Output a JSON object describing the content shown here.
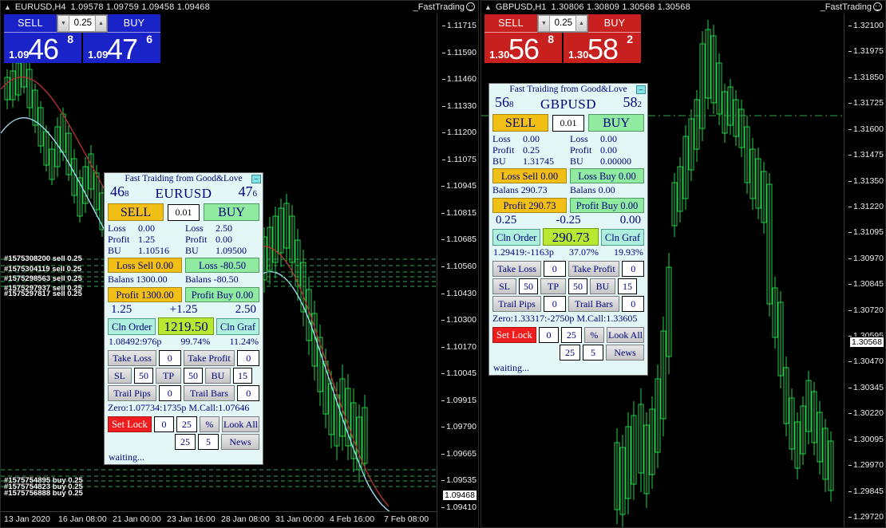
{
  "charts": [
    {
      "id": "left",
      "header": {
        "symbol": "EURUSD,H4",
        "ohlc": "1.09578 1.09759 1.09458 1.09468",
        "right_label": "_FastTrading",
        "smiley_icon": "smiley-icon",
        "arrow_icon": "triangle-up-icon"
      },
      "oneclick": {
        "sell_label": "SELL",
        "buy_label": "BUY",
        "volume": "0.25",
        "down_icon": "chevron-down-icon",
        "up_icon": "chevron-up-icon",
        "sell_price": {
          "prefix": "1.09",
          "big": "46",
          "sup": "8"
        },
        "buy_price": {
          "prefix": "1.09",
          "big": "47",
          "sup": "6"
        },
        "color": "#1a23c8"
      },
      "price_ticks": [
        "1.11715",
        "1.11590",
        "1.11460",
        "1.11330",
        "1.11200",
        "1.11075",
        "1.10945",
        "1.10815",
        "1.10685",
        "1.10560",
        "1.10430",
        "1.10300",
        "1.10170",
        "1.10045",
        "1.09915",
        "1.09790",
        "1.09665",
        "1.09535",
        "1.09410"
      ],
      "current_price": "1.09468",
      "time_ticks": [
        "13 Jan 2020",
        "16 Jan 08:00",
        "21 Jan 00:00",
        "23 Jan 16:00",
        "28 Jan 08:00",
        "31 Jan 00:00",
        "4 Feb 16:00",
        "7 Feb 08:00"
      ],
      "order_labels": [
        "#1575308200 sell 0.25",
        "#1575304119 sell 0.25",
        "#1575298563 sell 0.25",
        "#1575297937 sell 0.25",
        "#1575297817 sell 0.25",
        "#1575754895 buy 0.25",
        "#1575754823 buy 0.25",
        "#1575756888 buy 0.25"
      ]
    },
    {
      "id": "right",
      "header": {
        "symbol": "GBPUSD,H1",
        "ohlc": "1.30806 1.30809 1.30568 1.30568",
        "right_label": "_FastTrading",
        "smiley_icon": "smiley-icon",
        "arrow_icon": "triangle-up-icon"
      },
      "oneclick": {
        "sell_label": "SELL",
        "buy_label": "BUY",
        "volume": "0.25",
        "down_icon": "chevron-down-icon",
        "up_icon": "chevron-up-icon",
        "sell_price": {
          "prefix": "1.30",
          "big": "56",
          "sup": "8"
        },
        "buy_price": {
          "prefix": "1.30",
          "big": "58",
          "sup": "2"
        },
        "color": "#c81f1f"
      },
      "price_ticks": [
        "1.32100",
        "1.31975",
        "1.31850",
        "1.31725",
        "1.31600",
        "1.31475",
        "1.31350",
        "1.31220",
        "1.31095",
        "1.30970",
        "1.30845",
        "1.30720",
        "1.30595",
        "1.30470",
        "1.30345",
        "1.30220",
        "1.30095",
        "1.29970",
        "1.29845",
        "1.29720"
      ],
      "current_price": "1.30568",
      "time_ticks": [],
      "order_labels": []
    }
  ],
  "panels": [
    {
      "id": "eurusd-panel",
      "title": "Fast Traiding from Good&Love",
      "minimize_label": "–",
      "bid": "46",
      "bid_sub": "8",
      "symbol": "EURUSD",
      "ask": "47",
      "ask_sub": "6",
      "sell_label": "SELL",
      "buy_label": "BUY",
      "lot": "0.01",
      "sell_col": {
        "loss_label": "Loss",
        "loss_value": "0.00",
        "profit_label": "Profit",
        "profit_value": "1.25",
        "bu_label": "BU",
        "bu_value": "1.10516",
        "loss_btn": "Loss Sell 0.00",
        "balans_label": "Balans",
        "balans_value": "1300.00",
        "profit_btn": "Profit 1300.00"
      },
      "buy_col": {
        "loss_label": "Loss",
        "loss_value": "2.50",
        "profit_label": "Profit",
        "profit_value": "0.00",
        "bu_label": "BU",
        "bu_value": "1.09500",
        "loss_btn": "Loss -80.50",
        "balans_label": "Balans",
        "balans_value": "-80.50",
        "profit_btn": "Profit Buy 0.00"
      },
      "triple": {
        "left": "1.25",
        "mid": "+1.25",
        "right": "2.50"
      },
      "cln_order": "Cln Order",
      "total": "1219.50",
      "cln_graf": "Cln Graf",
      "stats": {
        "left": "1.08492:976p",
        "mid": "99.74%",
        "right": "11.24%"
      },
      "take_loss_label": "Take Loss",
      "take_loss_value": "0",
      "take_profit_label": "Take Profit",
      "take_profit_value": "0",
      "sl_label": "SL",
      "sl_value": "50",
      "tp_label": "TP",
      "tp_value": "50",
      "bu_label": "BU",
      "bu_value": "15",
      "trail_pips_label": "Trail Pips",
      "trail_pips_value": "0",
      "trail_bars_label": "Trail Bars",
      "trail_bars_value": "0",
      "zero_line": "Zero:1.07734:1735p   M.Call:1.07646",
      "set_lock": "Set Lock",
      "lock_v1": "0",
      "lock_v2": "25",
      "pct_label": "%",
      "look_all": "Look All",
      "row_v1": "25",
      "row_v2": "5",
      "news_label": "News",
      "status": "waiting..."
    },
    {
      "id": "gbpusd-panel",
      "title": "Fast Traiding from Good&Love",
      "minimize_label": "–",
      "bid": "56",
      "bid_sub": "8",
      "symbol": "GBPUSD",
      "ask": "58",
      "ask_sub": "2",
      "sell_label": "SELL",
      "buy_label": "BUY",
      "lot": "0.01",
      "sell_col": {
        "loss_label": "Loss",
        "loss_value": "0.00",
        "profit_label": "Profit",
        "profit_value": "0.25",
        "bu_label": "BU",
        "bu_value": "1.31745",
        "loss_btn": "Loss Sell 0.00",
        "balans_label": "Balans",
        "balans_value": "290.73",
        "profit_btn": "Profit 290.73"
      },
      "buy_col": {
        "loss_label": "Loss",
        "loss_value": "0.00",
        "profit_label": "Profit",
        "profit_value": "0.00",
        "bu_label": "BU",
        "bu_value": "0.00000",
        "loss_btn": "Loss Buy 0.00",
        "balans_label": "Balans",
        "balans_value": "0.00",
        "profit_btn": "Profit Buy 0.00"
      },
      "triple": {
        "left": "0.25",
        "mid": "-0.25",
        "right": "0.00"
      },
      "cln_order": "Cln Order",
      "total": "290.73",
      "cln_graf": "Cln Graf",
      "stats": {
        "left": "1.29419:-1163p",
        "mid": "37.07%",
        "right": "19.93%"
      },
      "take_loss_label": "Take Loss",
      "take_loss_value": "0",
      "take_profit_label": "Take Profit",
      "take_profit_value": "0",
      "sl_label": "SL",
      "sl_value": "50",
      "tp_label": "TP",
      "tp_value": "50",
      "bu_label": "BU",
      "bu_value": "15",
      "trail_pips_label": "Trail Pips",
      "trail_pips_value": "0",
      "trail_bars_label": "Trail Bars",
      "trail_bars_value": "0",
      "zero_line": "Zero:1.33317:-2750p  M.Call:1.33605",
      "set_lock": "Set Lock",
      "lock_v1": "0",
      "lock_v2": "25",
      "pct_label": "%",
      "look_all": "Look All",
      "row_v1": "25",
      "row_v2": "5",
      "news_label": "News",
      "status": "waiting..."
    }
  ],
  "colors": {
    "bull_candle": "#24d24a",
    "ma_red": "#b03030",
    "ma_blue": "#9fd8f0",
    "level_green": "#2fa84f",
    "chart_bg": "#000000",
    "panel_bg": "#e3f7f7",
    "panel_text": "#00007a"
  }
}
